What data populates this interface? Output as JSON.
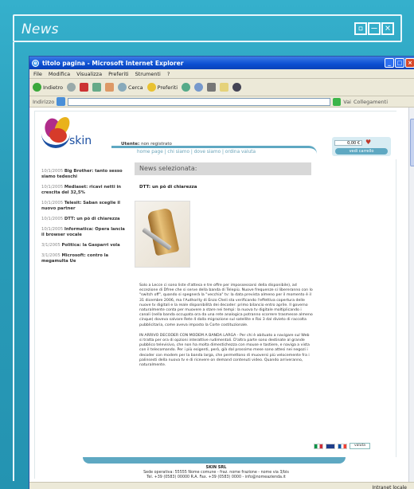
{
  "frame": {
    "title": "News",
    "controls": [
      "restore-control",
      "minimize-control",
      "close-control"
    ]
  },
  "ie": {
    "title": "titolo pagina - Microsoft Internet Explorer",
    "menu": [
      "File",
      "Modifica",
      "Visualizza",
      "Preferiti",
      "Strumenti",
      "?"
    ],
    "toolbar": {
      "back": "Indietro",
      "search": "Cerca",
      "favorites": "Preferiti"
    },
    "address_label": "Indirizzo",
    "go_label": "Vai",
    "links_label": "Collegamenti",
    "status_zone": "Intranet locale"
  },
  "site": {
    "brand": "skin",
    "user_label": "Utente:",
    "user_value": "non registrato",
    "nav": "home page | chi siamo | dove siamo | ordina valuta",
    "cart_value": "0,00 €",
    "cart_button": "vedi carrello",
    "main_title": "News selezionata:",
    "article_title": "DTT: un pò di chiarezza",
    "news": [
      {
        "date": "10/1/2005",
        "title": "Big Brother: tanto sesso siamo tedeschi"
      },
      {
        "date": "10/1/2005",
        "title": "Mediaset: ricavi netti in crescita del 32,5%"
      },
      {
        "date": "10/1/2005",
        "title": "Telesit: Saban sceglie il nuovo partner"
      },
      {
        "date": "10/1/2005",
        "title": "DTT: un pò di chiarezza"
      },
      {
        "date": "10/1/2005",
        "title": "Informatica: Opera lancia il browser vocale"
      },
      {
        "date": "3/1/2005",
        "title": "Politica: la Gasparri vola"
      },
      {
        "date": "3/1/2005",
        "title": "Microsoft: contro la megamulta Ue"
      }
    ],
    "body": [
      "Solo a Lecce ci sono liste d'attesa e tre offre per impossessarsi della disponibile), ad eccezione di Dfree che si serve della banda di Telepiù. Nuove frequenze si libereranno con lo \"switch off\", quando si spegnerà la \"vecchia\" tv: la data prevista almeno per il momento è il 31 dicembre 2006, ma l'Authority di Enzo Cheli sta verificando l'effettiva copertura delle nuove tv digitali e la reale disponibilità dei decoder: primo bilancio entro aprile. Il governo naturalmente conta per muovere a stare nei tempi: la nuova tv digitale moltiplicando i canali (nella banda occupata ora da una rete analogica potranno scorrere trasmesse almeno cinque) doveva salvare Rete 4 dalla migrazione sul satellite e Rai 3 dal divieto di raccolta pubblicitaria, come aveva imposto la Corte costituzionale.",
      "IN ARRIVO DECODER CON MODEM A BANDA LARGA - Per chi è abituato a navigare sul Web si tratta per ora di opzioni interattive rudimentali. D'altra parte sono destinate al grande pubblico televisivo, che non ha molta dimestichezza con mouse e tastiere, e naviga a vista con il telecomando. Per i più esigenti, però, già dal prossimo mese sono attesi nei negozi i decoder con modem per la banda larga, che permettono di muoversi più velocemente fra i palinsesti della nuova tv e di ricevere on demand contenuti video. Quando arriveranno, naturalmente."
    ],
    "valuta_label": "valuta",
    "footer": {
      "name": "SKIN SRL",
      "line1": "Sede operativa: 55555 Nome comune - fraz. nome frazione - nome via 3/bis",
      "line2": "Tel. +39 (0583) 00000 R.A. Fax. +39 (0583) 0000 - info@nomeazienda.it"
    }
  }
}
